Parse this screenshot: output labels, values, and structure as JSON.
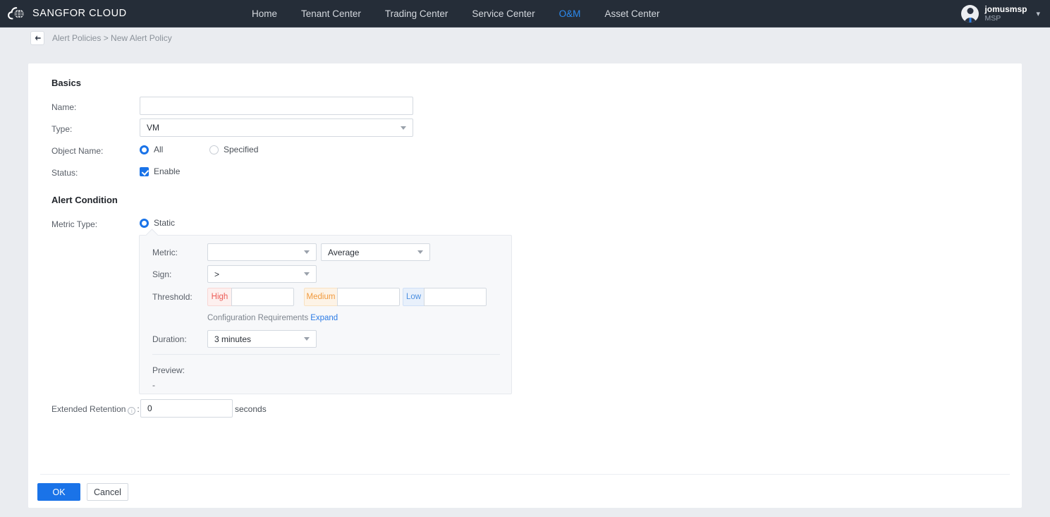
{
  "topnav": {
    "brand": "SANGFOR CLOUD",
    "brand_logo_icon": "cloud-globe-icon",
    "links": [
      {
        "label": "Home",
        "active": false
      },
      {
        "label": "Tenant Center",
        "active": false
      },
      {
        "label": "Trading Center",
        "active": false
      },
      {
        "label": "Service Center",
        "active": false
      },
      {
        "label": "O&M",
        "active": true
      },
      {
        "label": "Asset Center",
        "active": false
      }
    ],
    "user": {
      "name": "jomusmsp",
      "role": "MSP",
      "avatar_icon": "user-avatar-icon",
      "caret_icon": "chevron-down-icon"
    },
    "active_color": "#2c8bf0",
    "background_color": "#252d38"
  },
  "breadcrumb": {
    "back_icon": "arrow-left-icon",
    "text": "Alert Policies > New Alert Policy",
    "parent": "Alert Policies",
    "current": "New Alert Policy"
  },
  "basics": {
    "title": "Basics",
    "name": {
      "label": "Name:",
      "value": "",
      "placeholder": ""
    },
    "type": {
      "label": "Type:",
      "value": "VM",
      "caret_icon": "chevron-down-icon"
    },
    "object_name": {
      "label": "Object Name:",
      "options": [
        {
          "label": "All",
          "selected": true
        },
        {
          "label": "Specified",
          "selected": false
        }
      ]
    },
    "status": {
      "label": "Status:",
      "checkbox_label": "Enable",
      "checked": true
    }
  },
  "alert_condition": {
    "title": "Alert Condition",
    "metric_type": {
      "label": "Metric Type:",
      "options": [
        {
          "label": "Static",
          "selected": true
        }
      ]
    },
    "panel": {
      "metric": {
        "label": "Metric:",
        "value": "",
        "aggregation_value": "Average",
        "caret_icon": "chevron-down-icon"
      },
      "sign": {
        "label": "Sign:",
        "value": ">",
        "caret_icon": "chevron-down-icon"
      },
      "threshold": {
        "label": "Threshold:",
        "levels": [
          {
            "tag": "High",
            "value": "",
            "color": "#ec5b56"
          },
          {
            "tag": "Medium",
            "value": "",
            "color": "#f09a3e"
          },
          {
            "tag": "Low",
            "value": "",
            "color": "#4b8fe0"
          }
        ]
      },
      "config_requirements": {
        "text": "Configuration Requirements",
        "link": "Expand"
      },
      "duration": {
        "label": "Duration:",
        "value": "3 minutes",
        "caret_icon": "chevron-down-icon"
      },
      "preview": {
        "label": "Preview:",
        "value": "-"
      }
    }
  },
  "extended_retention": {
    "label": "Extended Retention",
    "info_icon": "info-icon",
    "colon": ":",
    "value": "0",
    "unit": "seconds"
  },
  "footer": {
    "ok_label": "OK",
    "cancel_label": "Cancel",
    "primary_color": "#1a73e8"
  }
}
